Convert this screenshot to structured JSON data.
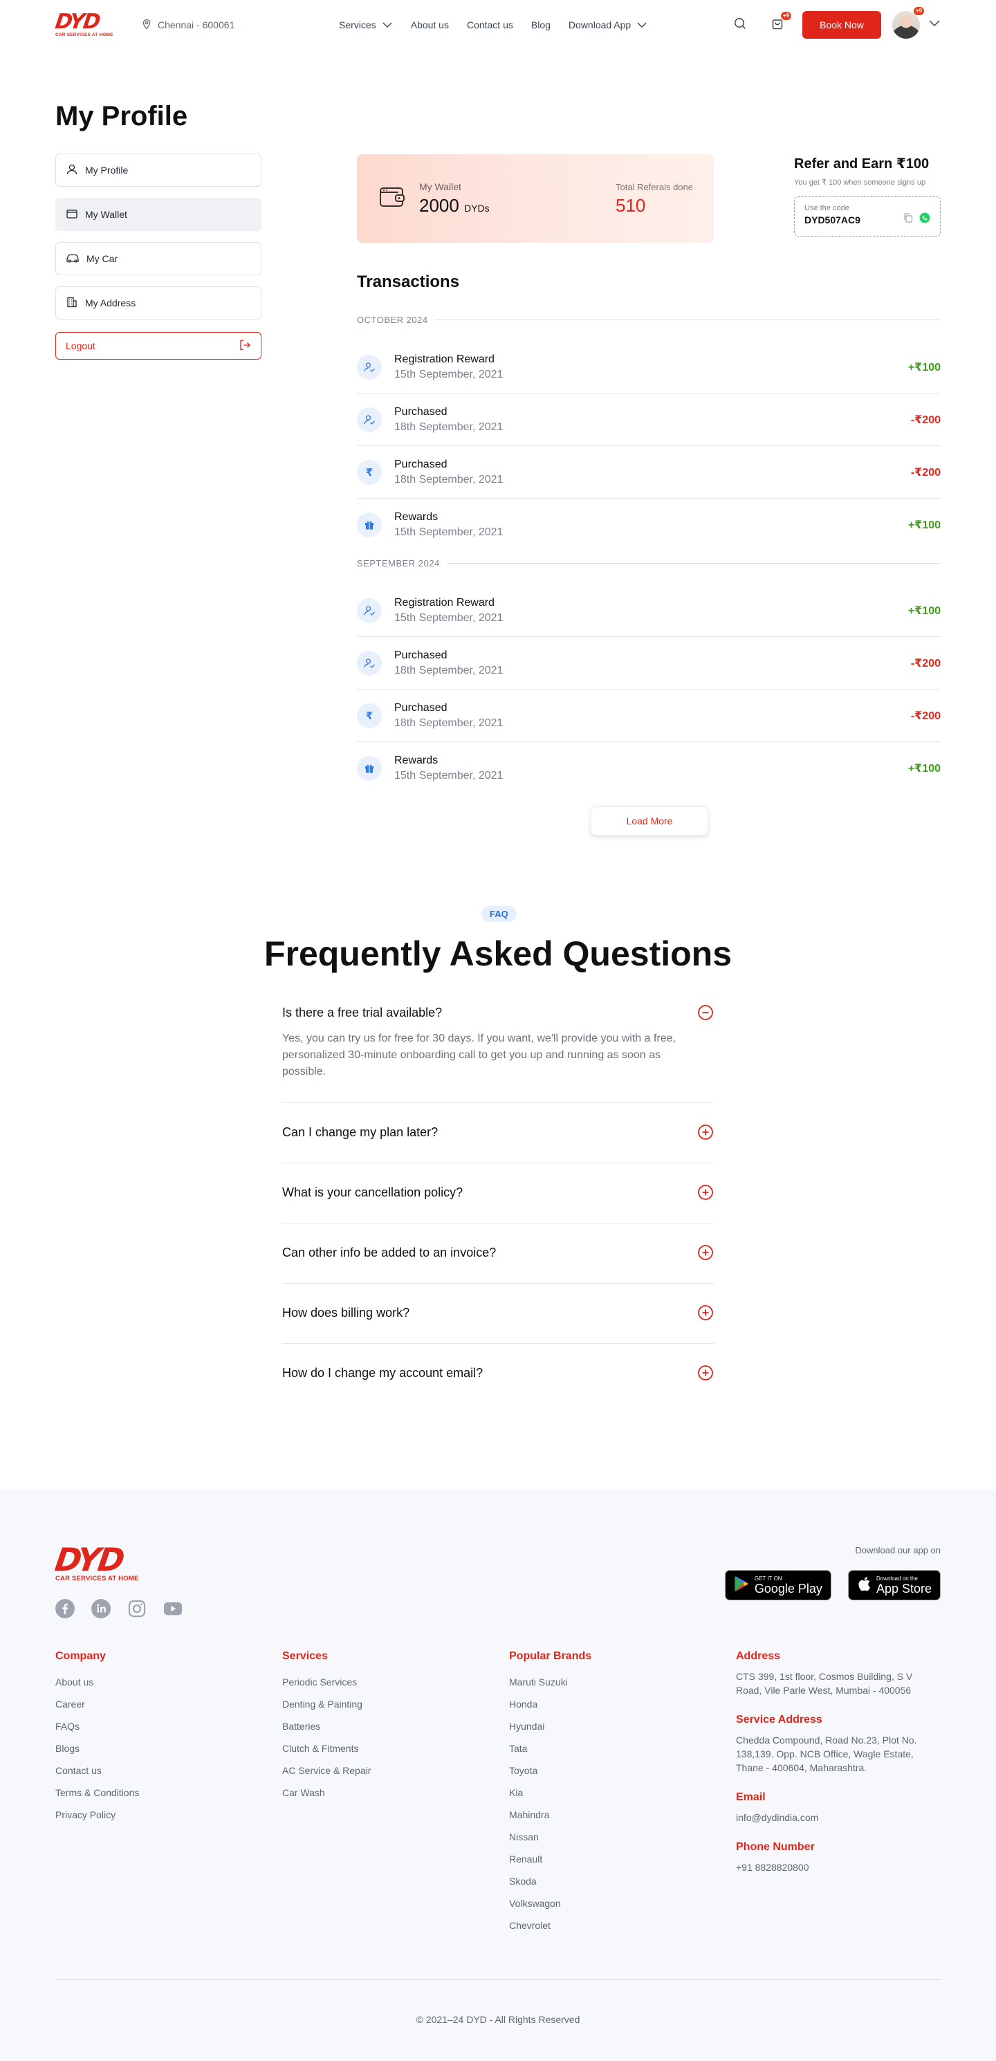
{
  "header": {
    "logo": {
      "mark": "DYD",
      "tagline": "CAR SERVICES AT HOME"
    },
    "location": "Chennai - 600061",
    "nav": [
      {
        "label": "Services",
        "has_dropdown": true
      },
      {
        "label": "About us",
        "has_dropdown": false
      },
      {
        "label": "Contact us",
        "has_dropdown": false
      },
      {
        "label": "Blog",
        "has_dropdown": false
      },
      {
        "label": "Download App",
        "has_dropdown": true
      }
    ],
    "cart_badge": "+9",
    "book_now": "Book Now",
    "avatar_badge": "+9"
  },
  "profile": {
    "title": "My Profile",
    "menu": [
      {
        "label": "My Profile",
        "icon": "user-icon",
        "active": false
      },
      {
        "label": "My Wallet",
        "icon": "wallet-icon",
        "active": true
      },
      {
        "label": "My Car",
        "icon": "car-icon",
        "active": false
      },
      {
        "label": "My Address",
        "icon": "building-icon",
        "active": false
      }
    ],
    "logout": "Logout"
  },
  "wallet": {
    "label": "My Wallet",
    "amount": "2000",
    "unit": "DYDs",
    "referrals_label": "Total Referals done",
    "referrals_count": "510"
  },
  "refer": {
    "title": "Refer and Earn ₹100",
    "subtitle": "You get ₹ 100 when someone signs up",
    "code_label": "Use the code",
    "code": "DYD507AC9"
  },
  "transactions": {
    "title": "Transactions",
    "load_more": "Load More",
    "groups": [
      {
        "month": "OCTOBER 2024",
        "items": [
          {
            "name": "Registration Reward",
            "date": "15th September, 2021",
            "amount": "+₹100",
            "type": "pos",
            "icon": "user-check-icon"
          },
          {
            "name": "Purchased",
            "date": "18th September, 2021",
            "amount": "-₹200",
            "type": "neg",
            "icon": "user-check-icon"
          },
          {
            "name": "Purchased",
            "date": "18th September, 2021",
            "amount": "-₹200",
            "type": "neg",
            "icon": "rupee-icon"
          },
          {
            "name": "Rewards",
            "date": "15th September, 2021",
            "amount": "+₹100",
            "type": "pos",
            "icon": "gift-icon"
          }
        ]
      },
      {
        "month": "SEPTEMBER 2024",
        "items": [
          {
            "name": "Registration Reward",
            "date": "15th September, 2021",
            "amount": "+₹100",
            "type": "pos",
            "icon": "user-check-icon"
          },
          {
            "name": "Purchased",
            "date": "18th September, 2021",
            "amount": "-₹200",
            "type": "neg",
            "icon": "user-check-icon"
          },
          {
            "name": "Purchased",
            "date": "18th September, 2021",
            "amount": "-₹200",
            "type": "neg",
            "icon": "rupee-icon"
          },
          {
            "name": "Rewards",
            "date": "15th September, 2021",
            "amount": "+₹100",
            "type": "pos",
            "icon": "gift-icon"
          }
        ]
      }
    ]
  },
  "faq": {
    "badge": "FAQ",
    "title": "Frequently Asked Questions",
    "items": [
      {
        "q": "Is there a free trial available?",
        "a": "Yes, you can try us for free for 30 days. If you want, we'll provide you with a free, personalized 30-minute onboarding call to get you up and running as soon as possible.",
        "open": true
      },
      {
        "q": "Can I change my plan later?",
        "a": "",
        "open": false
      },
      {
        "q": "What is your cancellation policy?",
        "a": "",
        "open": false
      },
      {
        "q": "Can other info be added to an invoice?",
        "a": "",
        "open": false
      },
      {
        "q": "How does billing work?",
        "a": "",
        "open": false
      },
      {
        "q": "How do I change my account email?",
        "a": "",
        "open": false
      }
    ]
  },
  "footer": {
    "logo": {
      "mark": "DYD",
      "tagline": "CAR SERVICES AT HOME"
    },
    "socials": [
      "facebook-icon",
      "linkedin-icon",
      "instagram-icon",
      "youtube-icon"
    ],
    "download_label": "Download our app on",
    "google_play": {
      "small": "GET IT ON",
      "big": "Google Play"
    },
    "app_store": {
      "small": "Download on the",
      "big": "App Store"
    },
    "company": {
      "title": "Company",
      "links": [
        "About us",
        "Career",
        "FAQs",
        "Blogs",
        "Contact us",
        "Terms & Conditions",
        "Privacy Policy"
      ]
    },
    "services": {
      "title": "Services",
      "links": [
        "Periodic Services",
        "Denting & Painting",
        "Batteries",
        "Clutch & Fitments",
        "AC Service & Repair",
        "Car Wash"
      ]
    },
    "brands": {
      "title": "Popular Brands",
      "links": [
        "Maruti Suzuki",
        "Honda",
        "Hyundai",
        "Tata",
        "Toyota",
        "Kia",
        "Mahindra",
        "Nissan",
        "Renault",
        "Skoda",
        "Volkswagon",
        "Chevrolet"
      ]
    },
    "contact": {
      "address_title": "Address",
      "address": "CTS 399, 1st floor, Cosmos Building, S V Road, Vile Parle West, Mumbai - 400056",
      "service_title": "Service Address",
      "service_address": "Chedda Compound, Road No.23, Plot No. 138,139. Opp. NCB Office, Wagle Estate, Thane - 400604, Maharashtra.",
      "email_title": "Email",
      "email": "info@dydindia.com",
      "phone_title": "Phone Number",
      "phone": "+91 8828820800"
    },
    "copyright": "© 2021–24 DYD - All Rights Reserved"
  },
  "colors": {
    "brand_red": "#e0261b",
    "positive": "#3f9b1c",
    "icon_blue": "#2f7ae0"
  }
}
